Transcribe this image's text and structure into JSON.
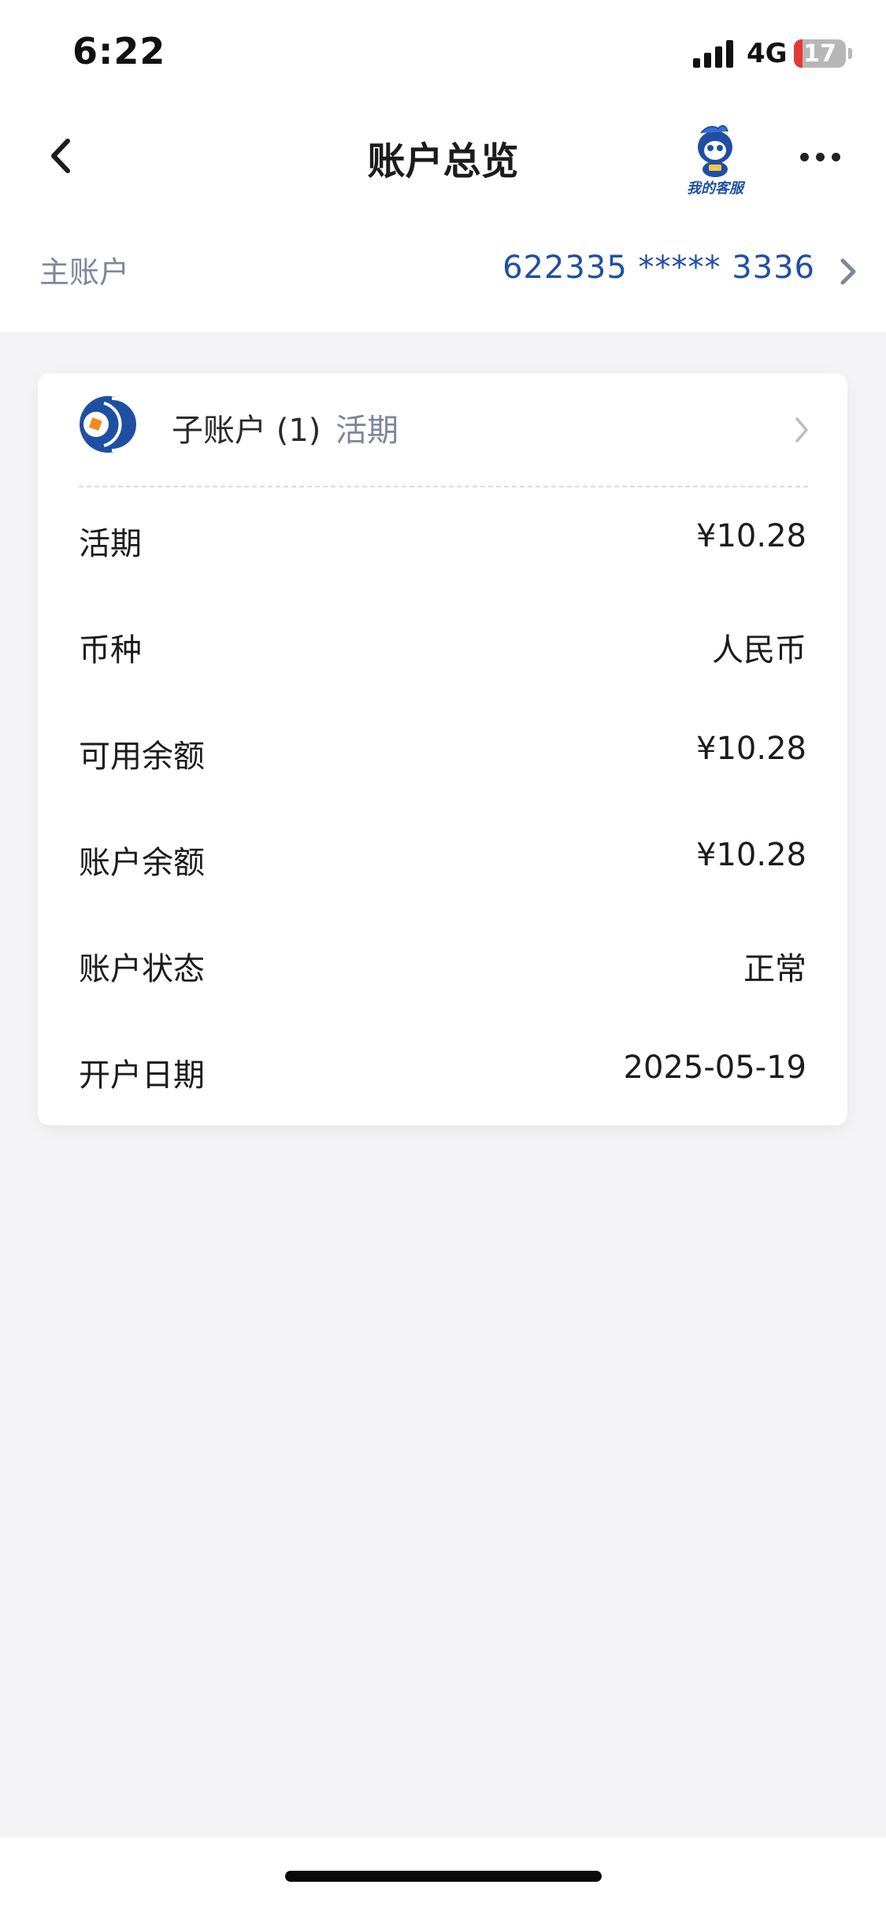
{
  "status_bar": {
    "time": "6:22",
    "network": "4G",
    "battery_level": "17",
    "battery_fraction": 0.17,
    "battery_low_color": "#e53935"
  },
  "nav": {
    "title": "账户总览",
    "back_icon": "chevron-left-icon",
    "customer_service_label": "我的客服",
    "more_icon": "more-dots-icon"
  },
  "main_account": {
    "label": "主账户",
    "number": "622335 ***** 3336"
  },
  "sub_account": {
    "title": "子账户 (1)",
    "type": "活期",
    "rows": [
      {
        "label": "活期",
        "value": "¥10.28"
      },
      {
        "label": "币种",
        "value": "人民币"
      },
      {
        "label": "可用余额",
        "value": "¥10.28"
      },
      {
        "label": "账户余额",
        "value": "¥10.28"
      },
      {
        "label": "账户状态",
        "value": "正常"
      },
      {
        "label": "开户日期",
        "value": "2025-05-19"
      }
    ]
  },
  "colors": {
    "accent_blue": "#1f4fa3",
    "muted_text": "#7d869c",
    "page_bg": "#f4f4f6",
    "logo_orange": "#f08a1c"
  }
}
